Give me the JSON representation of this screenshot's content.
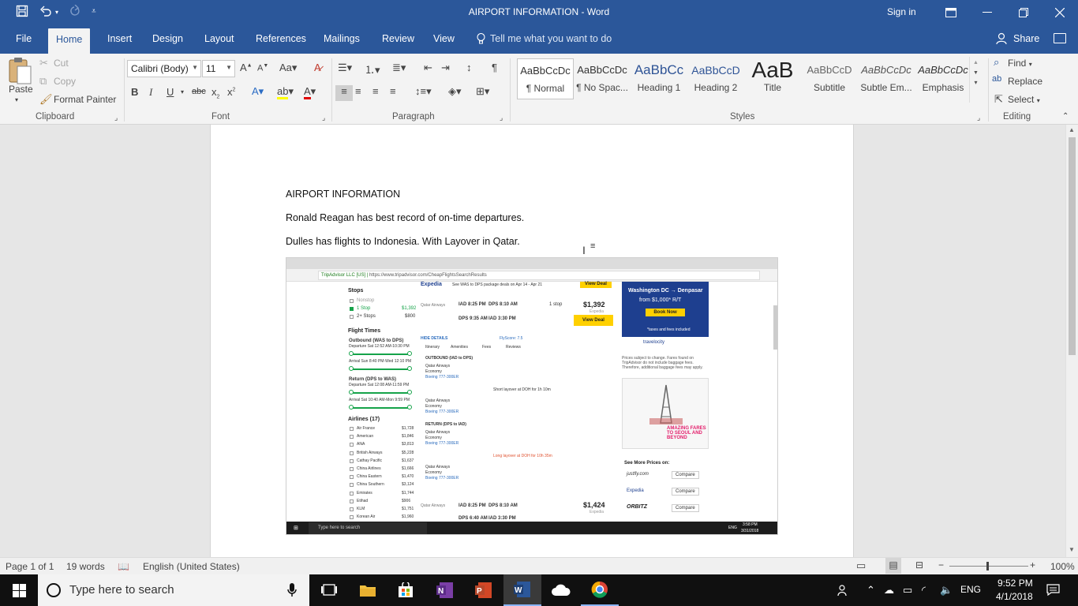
{
  "window": {
    "title": "AIRPORT INFORMATION  -  Word",
    "sign_in": "Sign in"
  },
  "tabs": [
    "File",
    "Home",
    "Insert",
    "Design",
    "Layout",
    "References",
    "Mailings",
    "Review",
    "View"
  ],
  "tell_me": "Tell me what you want to do",
  "share": "Share",
  "clipboard": {
    "paste": "Paste",
    "cut": "Cut",
    "copy": "Copy",
    "format_painter": "Format Painter",
    "label": "Clipboard"
  },
  "font": {
    "family": "Calibri (Body)",
    "size": "11",
    "label": "Font"
  },
  "paragraph": {
    "label": "Paragraph"
  },
  "styles": {
    "label": "Styles",
    "items": [
      {
        "preview": "AaBbCcDc",
        "name": "¶ Normal"
      },
      {
        "preview": "AaBbCcDc",
        "name": "¶ No Spac..."
      },
      {
        "preview": "AaBbCc",
        "name": "Heading 1"
      },
      {
        "preview": "AaBbCcD",
        "name": "Heading 2"
      },
      {
        "preview": "AaB",
        "name": "Title"
      },
      {
        "preview": "AaBbCcD",
        "name": "Subtitle"
      },
      {
        "preview": "AaBbCcDc",
        "name": "Subtle Em..."
      },
      {
        "preview": "AaBbCcDc",
        "name": "Emphasis"
      }
    ]
  },
  "editing": {
    "find": "Find",
    "replace": "Replace",
    "select": "Select",
    "label": "Editing"
  },
  "document": {
    "heading": "AIRPORT INFORMATION",
    "line1": "Ronald Reagan has best record of on-time departures.",
    "line2": "Dulles has flights to Indonesia.  With Layover in Qatar."
  },
  "embedded": {
    "url_site": "TripAdvisor LLC [US]",
    "url": "https://www.tripadvisor.com/CheapFlightsSearchResults",
    "expedia": "Expedia",
    "expedia_note": "See WAS to DPS package deals on Apr 14 - Apr 21",
    "view_deal": "View Deal",
    "stops_title": "Stops",
    "stops": [
      "Nonstop",
      "1 Stop",
      "2+ Stops"
    ],
    "stop_prices": [
      "",
      "$1,392",
      "$800"
    ],
    "flight_times": "Flight Times",
    "outbound": "Outbound (WAS to DPS)",
    "departure1": "Departure Sat 12:52 AM-10:30 PM",
    "arrival1": "Arrival Sun 8:40 PM-Wed 12:10 PM",
    "return_label": "Return (DPS to WAS)",
    "departure2": "Departure Sat 12:08 AM-11:59 PM",
    "arrival2": "Arrival Sat 10:40 AM-Mon 9:59 PM",
    "airlines_title": "Airlines (17)",
    "airlines": [
      "Air France",
      "American",
      "ANA",
      "British Airways",
      "Cathay Pacific",
      "China Airlines",
      "China Eastern",
      "China Southern",
      "Emirates",
      "Etihad",
      "KLM",
      "Korean Air"
    ],
    "airline_prices": [
      "$1,728",
      "$1,846",
      "$3,813",
      "$5,228",
      "$1,637",
      "$1,666",
      "$1,470",
      "$3,124",
      "$1,744",
      "$906",
      "$1,751",
      "$1,960"
    ],
    "itin1_out": "IAD 8:25 PM",
    "itin1_out_arr": "DPS 8:10 AM",
    "itin1_ret": "DPS 9:35 AM",
    "itin1_ret_arr": "IAD 3:30 PM",
    "itin1_stops": "1 stop",
    "itin1_price": "$1,392",
    "itin1_vendor": "Expedia",
    "hide_details": "HIDE DETAILS",
    "fly_score": "FlyScore: 7.5",
    "detail_tabs": [
      "Itinerary",
      "Amenities",
      "Fees",
      "Reviews"
    ],
    "outbound_hdr": "OUTBOUND (IAD to DPS)",
    "return_hdr": "RETURN (DPS to IAD)",
    "qatar": "Qatar Airways",
    "economy": "Economy",
    "boeing": "Boeing 777-300ER",
    "short_layover": "Short layover at DOH for 1h 10m",
    "long_layover": "Long layover at DOH for 10h 35m",
    "itin2_out": "IAD 8:25 PM",
    "itin2_out_arr": "DPS 8:10 AM",
    "itin2_ret": "DPS 6:40 AM",
    "itin2_ret_arr": "IAD 3:30 PM",
    "itin2_price": "$1,424",
    "itin2_vendor": "Expedia",
    "ad_title": "Washington DC → Denpasar",
    "ad_price": "from $1,000* R/T",
    "ad_book": "Book Now",
    "ad_note": "*taxes and fees included",
    "ad_brand": "travelocity",
    "prices_note": "Prices subject to change. Fares found on TripAdvisor do not include baggage fees. Therefore, additional baggage fees may apply.",
    "amazing_fares": "AMAZING FARES TO SEOUL AND BEYOND",
    "see_more": "See More Prices on:",
    "compare_sites": [
      "justfly.com",
      "Expedia",
      "ORBITZ"
    ],
    "compare": "Compare",
    "taskbar_search": "Type here to search",
    "tray_time": "3:58 PM",
    "tray_date": "3/31/2018",
    "tray_lang": "ENG"
  },
  "status": {
    "page": "Page 1 of 1",
    "words": "19 words",
    "language": "English (United States)",
    "zoom": "100%"
  },
  "taskbar": {
    "search": "Type here to search",
    "time": "9:52 PM",
    "date": "4/1/2018",
    "lang": "ENG"
  }
}
